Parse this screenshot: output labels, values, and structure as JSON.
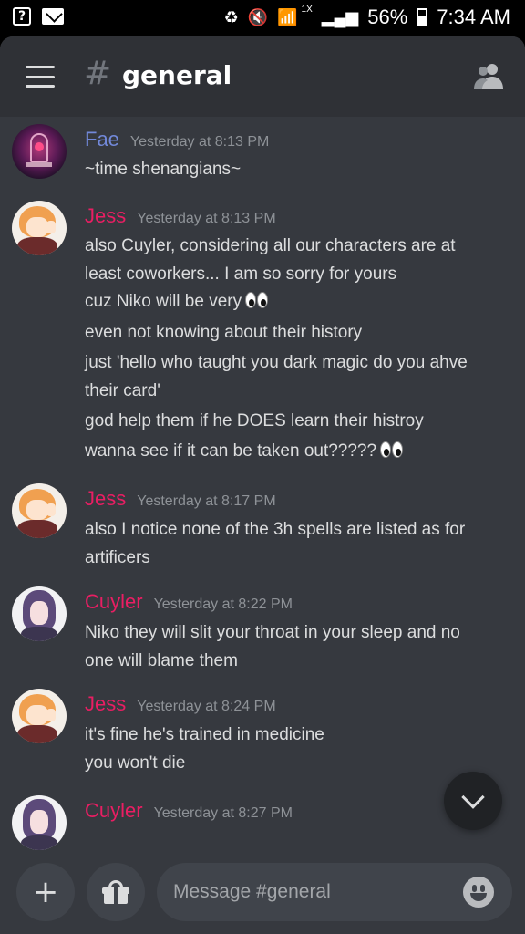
{
  "status_bar": {
    "battery": "56%",
    "time": "7:34 AM",
    "network_badge": "1X"
  },
  "header": {
    "hash": "#",
    "channel": "general"
  },
  "colors": {
    "fae": "#7289da",
    "jess": "#e91e63",
    "cuyler": "#e91e63"
  },
  "messages": [
    {
      "author": "Fae",
      "time": "Yesterday at 8:13 PM",
      "lines": [
        "~time shenangians~"
      ]
    },
    {
      "author": "Jess",
      "time": "Yesterday at 8:13 PM",
      "lines": [
        "also Cuyler, considering all our characters are at",
        "least coworkers... I am so sorry for yours",
        "cuz Niko will be very",
        "even not knowing about their history",
        "just 'hello who taught you dark magic do you ahve",
        "their card'",
        "god help them if he DOES learn their histroy",
        "wanna see if it can be taken out?????"
      ]
    },
    {
      "author": "Jess",
      "time": "Yesterday at 8:17 PM",
      "lines": [
        "also I notice none of the 3h spells are listed as for",
        "artificers"
      ]
    },
    {
      "author": "Cuyler",
      "time": "Yesterday at 8:22 PM",
      "lines": [
        "Niko they will slit your throat in your sleep and no",
        "one will blame them"
      ]
    },
    {
      "author": "Jess",
      "time": "Yesterday at 8:24 PM",
      "lines": [
        "it's fine he's trained in medicine",
        "you won't die"
      ]
    },
    {
      "author": "Cuyler",
      "time": "Yesterday at 8:27 PM",
      "lines": []
    }
  ],
  "composer": {
    "placeholder": "Message #general"
  }
}
